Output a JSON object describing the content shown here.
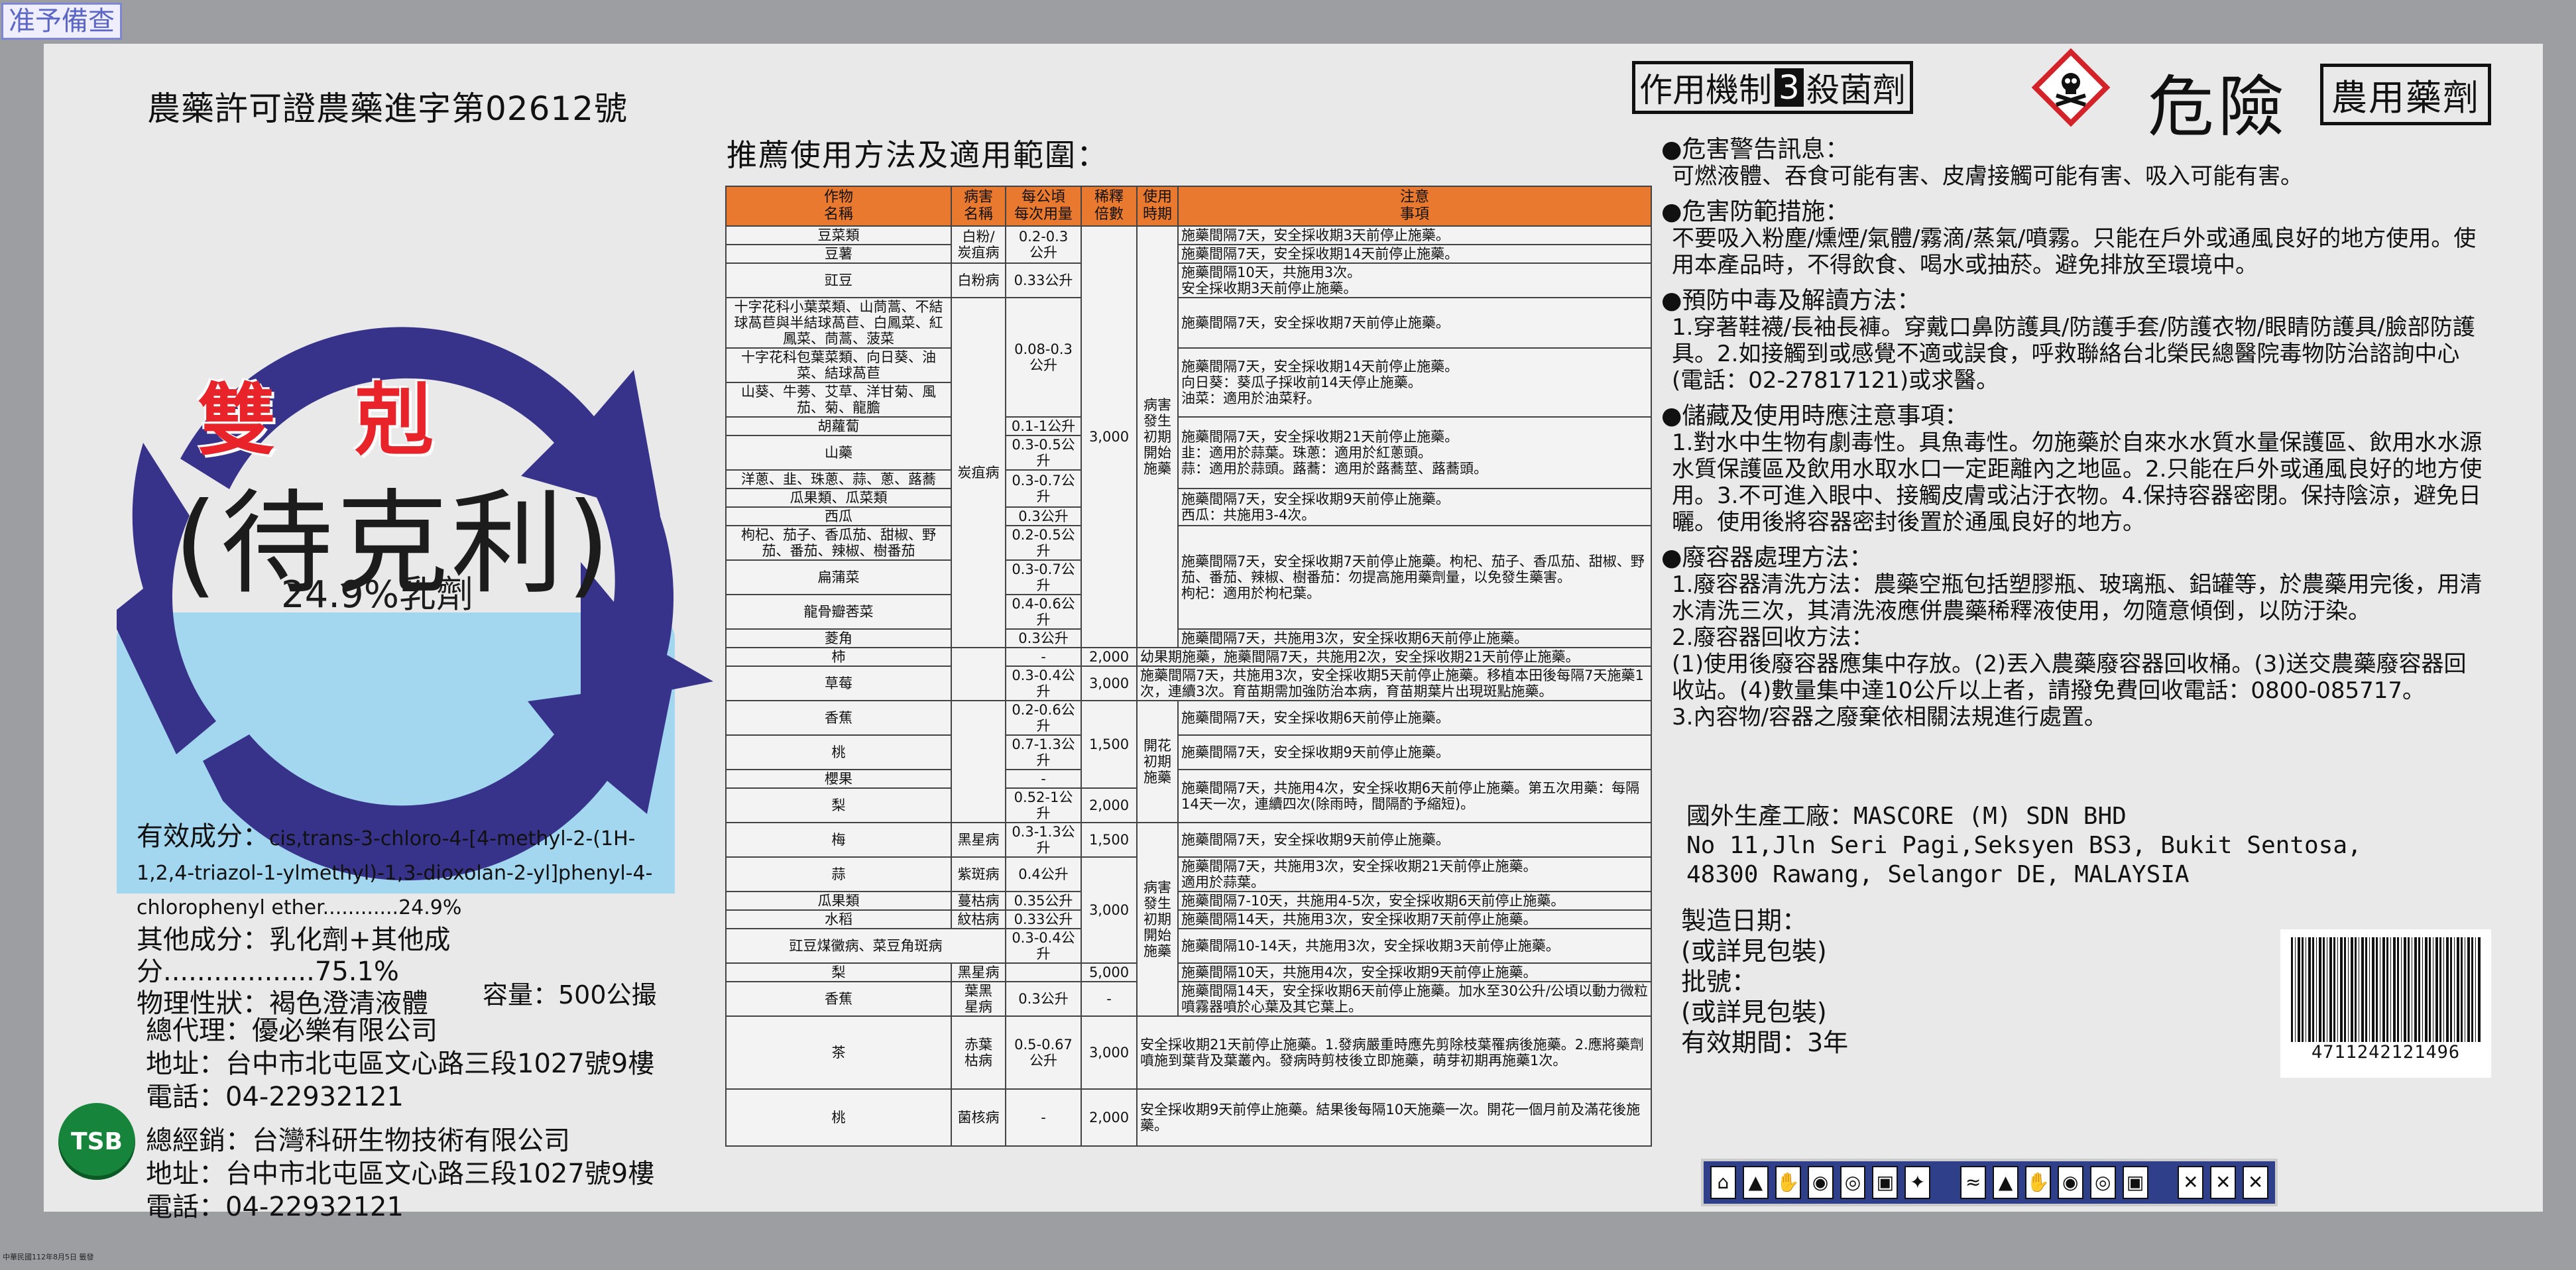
{
  "stamp": "准予備查",
  "footer_note": "中華民國112年8月5日 籤發",
  "permit": "農藥許可證農藥進字第02612號",
  "product": {
    "name_main": "雙剋",
    "name_sub": "(待克利)",
    "concentration": "24.9%乳劑"
  },
  "ingredients": {
    "active_label": "有效成分：",
    "active_text": "cis,trans-3-chloro-4-[4-methyl-2-(1H-1,2,4-triazol-1-ylmethyl)-1,3-dioxolan-2-yl]phenyl-4-chlorophenyl ether............24.9%",
    "other": "其他成分：乳化劑+其他成分..................75.1%",
    "property": "物理性狀：褐色澄清液體"
  },
  "volume": "容量：500公撮",
  "agent": {
    "l1": "總代理：優必樂有限公司",
    "l2": "地址：台中市北屯區文心路三段1027號9樓",
    "l3": "電話：04-22932121",
    "l4": "總經銷：台灣科研生物技術有限公司",
    "l5": "地址：台中市北屯區文心路三段1027號9樓",
    "l6": "電話：04-22932121",
    "tsb": "TSB"
  },
  "table": {
    "title": "推薦使用方法及適用範圍：",
    "headers": [
      "作物\n名稱",
      "病害\n名稱",
      "每公頃\n每次用量",
      "稀釋\n倍數",
      "使用\n時期",
      "注意\n事項"
    ],
    "r1": [
      "豆菜類",
      "白粉/\n炭疽病",
      "0.2-0.3\n公升",
      "3,000",
      "病害\n發生\n初期\n開始\n施藥",
      "施藥間隔7天，安全採收期3天前停止施藥。"
    ],
    "r2": [
      "豆薯",
      "施藥間隔7天，安全採收期14天前停止施藥。"
    ],
    "r3": [
      "豇豆",
      "白粉病",
      "0.33公升",
      "施藥間隔10天，共施用3次。\n安全採收期3天前停止施藥。"
    ],
    "r4": [
      "十字花科小葉菜類、山茼蒿、不結球萵苣與半結球萵苣、白鳳菜、紅鳳菜、茼蒿、菠菜",
      "炭疽病",
      "0.08-0.3\n公升",
      "施藥間隔7天，安全採收期7天前停止施藥。"
    ],
    "r5": [
      "十字花科包葉菜類、向日葵、油菜、結球萵苣",
      "施藥間隔7天，安全採收期14天前停止施藥。\n向日葵：葵瓜子採收前14天停止施藥。\n油菜：適用於油菜籽。"
    ],
    "r6": [
      "山葵、牛蒡、艾草、洋甘菊、風茄、菊、龍膽"
    ],
    "r7": [
      "胡蘿蔔",
      "0.1-1公升",
      "施藥間隔7天，安全採收期21天前停止施藥。\n韭：適用於蒜葉。珠蔥：適用於紅蔥頭。\n蒜：適用於蒜頭。蕗蕎：適用於蕗蕎莖、蕗蕎頭。"
    ],
    "r8": [
      "山藥",
      "0.3-0.5公升"
    ],
    "r9": [
      "洋蔥、韭、珠蔥、蒜、蔥、蕗蕎",
      "0.3-0.7公升"
    ],
    "r10": [
      "瓜果類、瓜菜類",
      "施藥間隔7天，安全採收期9天前停止施藥。\n西瓜：共施用3-4次。"
    ],
    "r11": [
      "西瓜",
      "0.3公升"
    ],
    "r12": [
      "枸杞、茄子、香瓜茄、甜椒、野茄、番茄、辣椒、樹番茄",
      "0.2-0.5公升",
      "施藥間隔7天，安全採收期7天前停止施藥。枸杞、茄子、香瓜茄、甜椒、野茄、番茄、辣椒、樹番茄：勿提高施用藥劑量，以免發生藥害。\n枸杞：適用於枸杞葉。"
    ],
    "r13": [
      "扁蒲菜",
      "0.3-0.7公升"
    ],
    "r14": [
      "龍骨瓣莕菜",
      "0.4-0.6公升"
    ],
    "r15": [
      "菱角",
      "0.3公升",
      "施藥間隔7天，共施用3次，安全採收期6天前停止施藥。"
    ],
    "r16": [
      "柿",
      "-",
      "2,000",
      "幼果期施藥，施藥間隔7天，共施用2次，安全採收期21天前停止施藥。"
    ],
    "r17": [
      "草莓",
      "0.3-0.4公升",
      "3,000",
      "施藥間隔7天，共施用3次，安全採收期5天前停止施藥。移植本田後每隔7天施藥1次，連續3次。育苗期需加強防治本病，育苗期葉片出現斑點施藥。"
    ],
    "r18": [
      "香蕉",
      "0.2-0.6公升",
      "施藥間隔7天，安全採收期6天前停止施藥。"
    ],
    "r19": [
      "桃",
      "0.7-1.3公升",
      "1,500",
      "開花\n初期\n施藥",
      "施藥間隔7天，安全採收期9天前停止施藥。"
    ],
    "r20": [
      "櫻果",
      "-",
      "施藥間隔7天，共施用4次，安全採收期6天前停止施藥。第五次用藥：每隔14天一次，連續四次(除雨時，間隔酌予縮短)。"
    ],
    "r21": [
      "梨",
      "0.52-1公升",
      "2,000"
    ],
    "r22": [
      "梅",
      "黑星病",
      "0.3-1.3公升",
      "1,500",
      "施藥間隔7天，安全採收期9天前停止施藥。"
    ],
    "r23": [
      "蒜",
      "紫斑病",
      "0.4公升",
      "3,000",
      "病害\n發生\n初期\n開始\n施藥",
      "施藥間隔7天，共施用3次，安全採收期21天前停止施藥。\n適用於蒜葉。"
    ],
    "r24": [
      "瓜果類",
      "蔓枯病",
      "0.35公升",
      "施藥間隔7-10天，共施用4-5次，安全採收期6天前停止施藥。"
    ],
    "r25": [
      "水稻",
      "紋枯病",
      "0.33公升",
      "施藥間隔14天，共施用3次，安全採收期7天前停止施藥。"
    ],
    "r26": [
      "豇豆煤黴病、菜豆角斑病",
      "0.3-0.4公升",
      "施藥間隔10-14天，共施用3次，安全採收期3天前停止施藥。"
    ],
    "r27": [
      "梨",
      "黑星病",
      "5,000",
      "施藥間隔10天，共施用4次，安全採收期9天前停止施藥。"
    ],
    "r28": [
      "香蕉",
      "葉黑\n星病",
      "0.3公升",
      "-",
      "施藥間隔14天，安全採收期6天前停止施藥。加水至30公升/公頃以動力微粒噴霧器噴於心葉及其它葉上。"
    ],
    "r29": [
      "茶",
      "赤葉\n枯病",
      "0.5-0.67\n公升",
      "3,000",
      "安全採收期21天前停止施藥。1.發病嚴重時應先剪除枝葉罹病後施藥。2.應將藥劑噴施到葉背及葉叢內。發病時剪枝後立即施藥，萌芽初期再施藥1次。"
    ],
    "r30": [
      "桃",
      "菌核病",
      "-",
      "2,000",
      "安全採收期9天前停止施藥。結果後每隔10天施藥一次。開花一個月前及滿花後施藥。"
    ]
  },
  "mechanism": {
    "a": "作用機制",
    "b": "3",
    "c": "殺菌劑"
  },
  "danger": "危險",
  "agri": "農用藥劑",
  "warnings": {
    "h1": "●危害警告訊息：",
    "t1": "可燃液體、吞食可能有害、皮膚接觸可能有害、吸入可能有害。",
    "h2": "●危害防範措施：",
    "t2": "不要吸入粉塵/燻煙/氣體/霧滴/蒸氣/噴霧。只能在戶外或通風良好的地方使用。使用本產品時，不得飲食、喝水或抽菸。避免排放至環境中。",
    "h3": "●預防中毒及解讀方法：",
    "t3": "1.穿著鞋襪/長袖長褲。穿戴口鼻防護具/防護手套/防護衣物/眼睛防護具/臉部防護具。2.如接觸到或感覺不適或誤食，呼救聯絡台北榮民總醫院毒物防治諮詢中心(電話：02-27817121)或求醫。",
    "h4": "●儲藏及使用時應注意事項：",
    "t4": "1.對水中生物有劇毒性。具魚毒性。勿施藥於自來水水質水量保護區、飲用水水源水質保護區及飲用水取水口一定距離內之地區。2.只能在戶外或通風良好的地方使用。3.不可進入眼中、接觸皮膚或沾汙衣物。4.保持容器密閉。保持陰涼，避免日曬。使用後將容器密封後置於通風良好的地方。",
    "h5": "●廢容器處理方法：",
    "t5a": "1.廢容器清洗方法：農藥空瓶包括塑膠瓶、玻璃瓶、鋁罐等，於農藥用完後，用清水清洗三次，其清洗液應併農藥稀釋液使用，勿隨意傾倒，以防汙染。",
    "t5b": "2.廢容器回收方法：",
    "t5c": "(1)使用後廢容器應集中存放。(2)丟入農藥廢容器回收桶。(3)送交農藥廢容器回收站。(4)數量集中達10公斤以上者，請撥免費回收電話：0800-085717。",
    "t5d": "3.內容物/容器之廢棄依相關法規進行處置。"
  },
  "manufacturer": {
    "l1": "國外生產工廠：MASCORE (M) SDN BHD",
    "l2": "No 11,Jln Seri Pagi,Seksyen BS3, Bukit Sentosa,",
    "l3": "48300 Rawang, Selangor DE, MALAYSIA"
  },
  "dates": {
    "l1": "製造日期：",
    "l2": "(或詳見包裝)",
    "l3": "批號：",
    "l4": "(或詳見包裝)",
    "l5": "有效期間：3年"
  },
  "barcode": "4711242121496"
}
